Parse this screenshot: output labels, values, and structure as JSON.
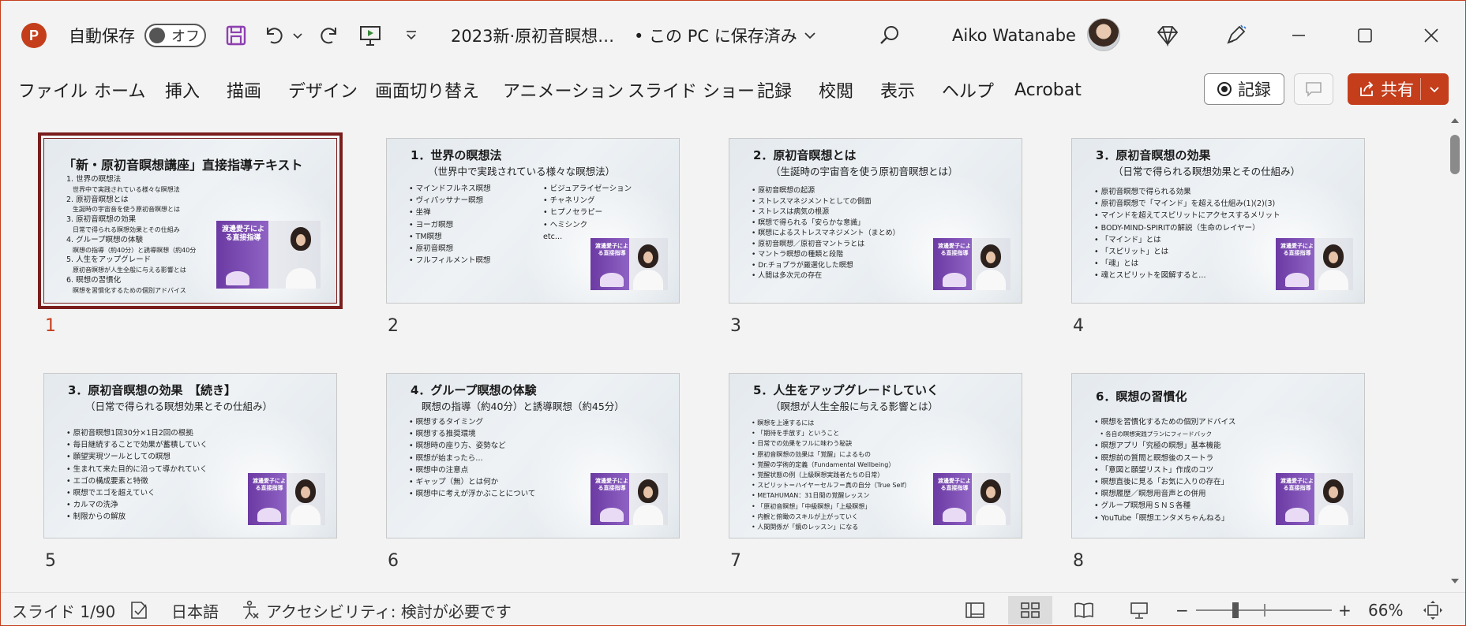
{
  "titlebar": {
    "app_logo": "P",
    "autosave_label": "自動保存",
    "autosave_toggle": "オフ",
    "doc_title": "2023新·原初音瞑想…",
    "save_status": "• この PC に保存済み",
    "user_name": "Aiko Watanabe",
    "icons": [
      "save-icon",
      "undo-icon",
      "redo-icon",
      "present-icon",
      "customize-icon",
      "search-icon",
      "diamond-icon",
      "pen-icon",
      "minimize-icon",
      "maximize-icon",
      "close-icon"
    ]
  },
  "ribbon": {
    "tabs": [
      "ファイル",
      "ホーム",
      "挿入",
      "描画",
      "デザイン",
      "画面切り替え",
      "アニメーション",
      "スライド ショー",
      "記録",
      "校閲",
      "表示",
      "ヘルプ",
      "Acrobat"
    ],
    "record_label": "記録",
    "share_label": "共有"
  },
  "photo_caption": "渡邊愛子による直接指導",
  "slides": [
    {
      "num": "1",
      "title": "「新・原初音瞑想講座」直接指導テキスト",
      "subtitle": "",
      "list": [
        "1. 世界の瞑想法",
        "　世界中で実践されている様々な瞑想法",
        "2. 原初音瞑想とは",
        "　生誕時の宇宙音を使う原初音瞑想とは",
        "3. 原初音瞑想の効果",
        "　日常で得られる瞑想効果とその仕組み",
        "4. グループ瞑想の体験",
        "　瞑想の指導（約40分）と誘導瞑想（約40分",
        "5. 人生をアップグレード",
        "　原初音瞑想が人生全般に与える影響とは",
        "6. 瞑想の習慣化",
        "　瞑想を習慣化するための個別アドバイス"
      ],
      "list2": []
    },
    {
      "num": "2",
      "title": "1．世界の瞑想法",
      "subtitle": "（世界中で実践されている様々な瞑想法）",
      "list": [
        "• マインドフルネス瞑想",
        "• ヴィパッサナー瞑想",
        "• 坐禅",
        "• ヨーガ瞑想",
        "• TM瞑想",
        "• 原初音瞑想",
        "• フルフィルメント瞑想"
      ],
      "list2": [
        "• ビジュアライゼーション",
        "• チャネリング",
        "• ヒプノセラピー",
        "• ヘミシンク",
        "etc…"
      ]
    },
    {
      "num": "3",
      "title": "2．原初音瞑想とは",
      "subtitle": "（生誕時の宇宙音を使う原初音瞑想とは）",
      "list": [
        "• 原初音瞑想の起源",
        "• ストレスマネジメントとしての側面",
        "• ストレスは病気の根源",
        "• 瞑想で得られる「安らかな意識」",
        "• 瞑想によるストレスマネジメント（まとめ）",
        "• 原初音瞑想／原初音マントラとは",
        "• マントラ瞑想の種類と段階",
        "• Dr.チョプラが厳選化した瞑想",
        "• 人間は多次元の存在"
      ],
      "list2": []
    },
    {
      "num": "4",
      "title": "3．原初音瞑想の効果",
      "subtitle": "（日常で得られる瞑想効果とその仕組み）",
      "list": [
        "• 原初音瞑想で得られる効果",
        "• 原初音瞑想で「マインド」を超える仕組み(1)(2)(3)",
        "• マインドを超えてスピリットにアクセスするメリット",
        "• BODY-MIND-SPIRITの解説（生命のレイヤー）",
        "• 「マインド」とは",
        "• 「スピリット」とは",
        "• 「魂」とは",
        "• 魂とスピリットを図解すると…"
      ],
      "list2": []
    },
    {
      "num": "5",
      "title": "3．原初音瞑想の効果　【続き】",
      "subtitle": "（日常で得られる瞑想効果とその仕組み）",
      "list": [
        "• 原初音瞑想1回30分×1日2回の根拠",
        "• 毎日継続することで効果が蓄積していく",
        "• 願望実現ツールとしての瞑想",
        "• 生まれて来た目的に沿って導かれていく",
        "• エゴの構成要素と特徴",
        "• 瞑想でエゴを超えていく",
        "• カルマの洗浄",
        "• 制限からの解放"
      ],
      "list2": []
    },
    {
      "num": "6",
      "title": "4．グループ瞑想の体験",
      "subtitle": "瞑想の指導（約40分）と誘導瞑想（約45分）",
      "list": [
        "• 瞑想するタイミング",
        "• 瞑想する推奨環境",
        "• 瞑想時の座り方、姿勢など",
        "• 瞑想が始まったら…",
        "• 瞑想中の注意点",
        "• ギャップ（無）とは何か",
        "• 瞑想中に考えが浮かぶことについて"
      ],
      "list2": []
    },
    {
      "num": "7",
      "title": "5．人生をアップグレードしていく",
      "subtitle": "（瞑想が人生全般に与える影響とは）",
      "list": [
        "• 瞑想を上達するには",
        "• 「期待を手放す」ということ",
        "• 日常での効果をフルに味わう秘訣",
        "• 原初音瞑想の効果は「覚醒」によるもの",
        "• 覚醒の学術的定義（Fundamental Wellbeing）",
        "• 覚醒状態の例（上級瞑想実践者たちの日常）",
        "• スピリット＝ハイヤーセルフ＝真の自分（True Self）",
        "• METAHUMAN：31日間の覚醒レッスン",
        "• 「原初音瞑想」「中級瞑想」「上級瞑想」",
        "• 内観と俯瞰のスキルが上がっていく",
        "• 人間関係が「鏡のレッスン」になる"
      ],
      "list2": []
    },
    {
      "num": "8",
      "title": "6．瞑想の習慣化",
      "subtitle": "",
      "list": [
        "• 瞑想を習慣化するための個別アドバイス",
        "　• 各自の瞑想実践プランにフィードバック",
        "• 瞑想アプリ「究極の瞑想」基本機能",
        "• 瞑想前の質問と瞑想後のスートラ",
        "• 「意図と願望リスト」作成のコツ",
        "• 瞑想直後に見る「お気に入りの存在」",
        "• 瞑想履歴／瞑想用音声との併用",
        "• グループ瞑想用ＳＮＳ各種",
        "• YouTube「瞑想エンタメちゃんねる」"
      ],
      "list2": []
    }
  ],
  "statusbar": {
    "slide_info": "スライド 1/90",
    "language": "日本語",
    "accessibility": "アクセシビリティ: 検討が必要です",
    "zoom_minus": "−",
    "zoom_plus": "+",
    "zoom_level": "66%"
  },
  "colors": {
    "accent": "#c43e1c",
    "selected_border": "#7a1d1d",
    "purple": "#6b3aa3"
  }
}
